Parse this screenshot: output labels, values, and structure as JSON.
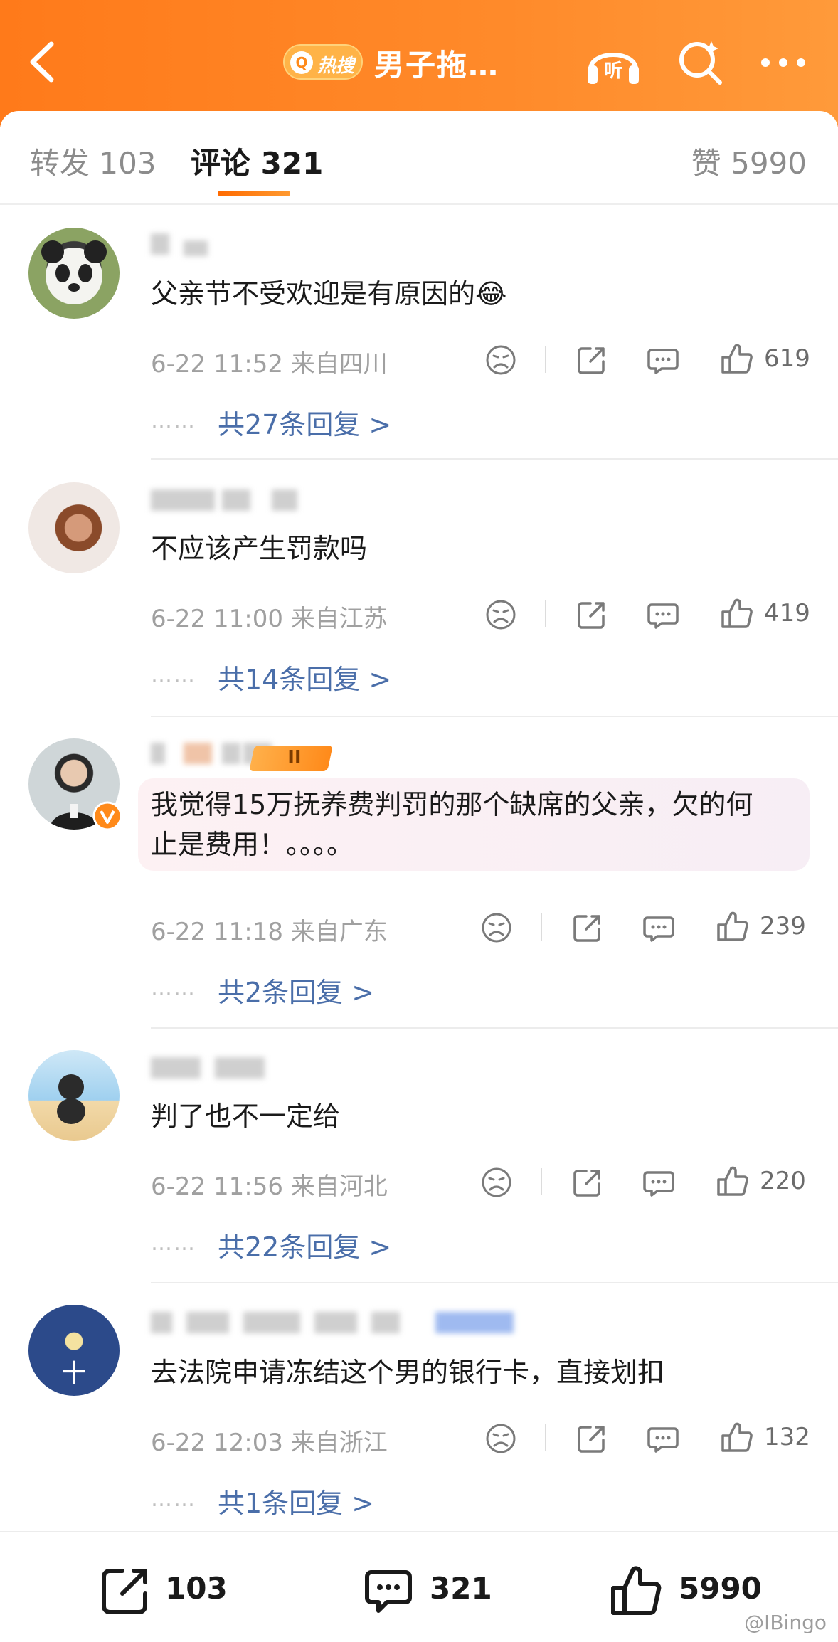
{
  "header": {
    "hot_label": "热搜",
    "title": "男子拖…",
    "listen_label": "听"
  },
  "tabs": {
    "forward": "转发 103",
    "comment": "评论 321",
    "like": "赞 5990"
  },
  "comments": [
    {
      "text": "父亲节不受欢迎是有原因的😂",
      "time_location": "6-22 11:52 来自四川",
      "likes": "619",
      "replies": "共27条回复 >"
    },
    {
      "text": "不应该产生罚款吗",
      "time_location": "6-22 11:00 来自江苏",
      "likes": "419",
      "replies": "共14条回复 >"
    },
    {
      "text_line1": "我觉得15万抚养费判罚的那个缺席的父亲，欠的何",
      "text_line2": "止是费用！。。。。",
      "badge": "II",
      "time_location": "6-22 11:18 来自广东",
      "likes": "239",
      "replies": "共2条回复 >"
    },
    {
      "text": "判了也不一定给",
      "time_location": "6-22 11:56 来自河北",
      "likes": "220",
      "replies": "共22条回复 >"
    },
    {
      "text": "去法院申请冻结这个男的银行卡，直接划扣",
      "time_location": "6-22 12:03 来自浙江",
      "likes": "132",
      "replies": "共1条回复 >"
    }
  ],
  "reply_dots": "……",
  "bottom": {
    "forward_count": "103",
    "comment_count": "321",
    "like_count": "5990"
  },
  "watermark": "@IBingo",
  "colors": {
    "header_orange": "#ff7a1a",
    "link_blue": "#4a6ea9",
    "tab_underline": "#ff6a00"
  }
}
